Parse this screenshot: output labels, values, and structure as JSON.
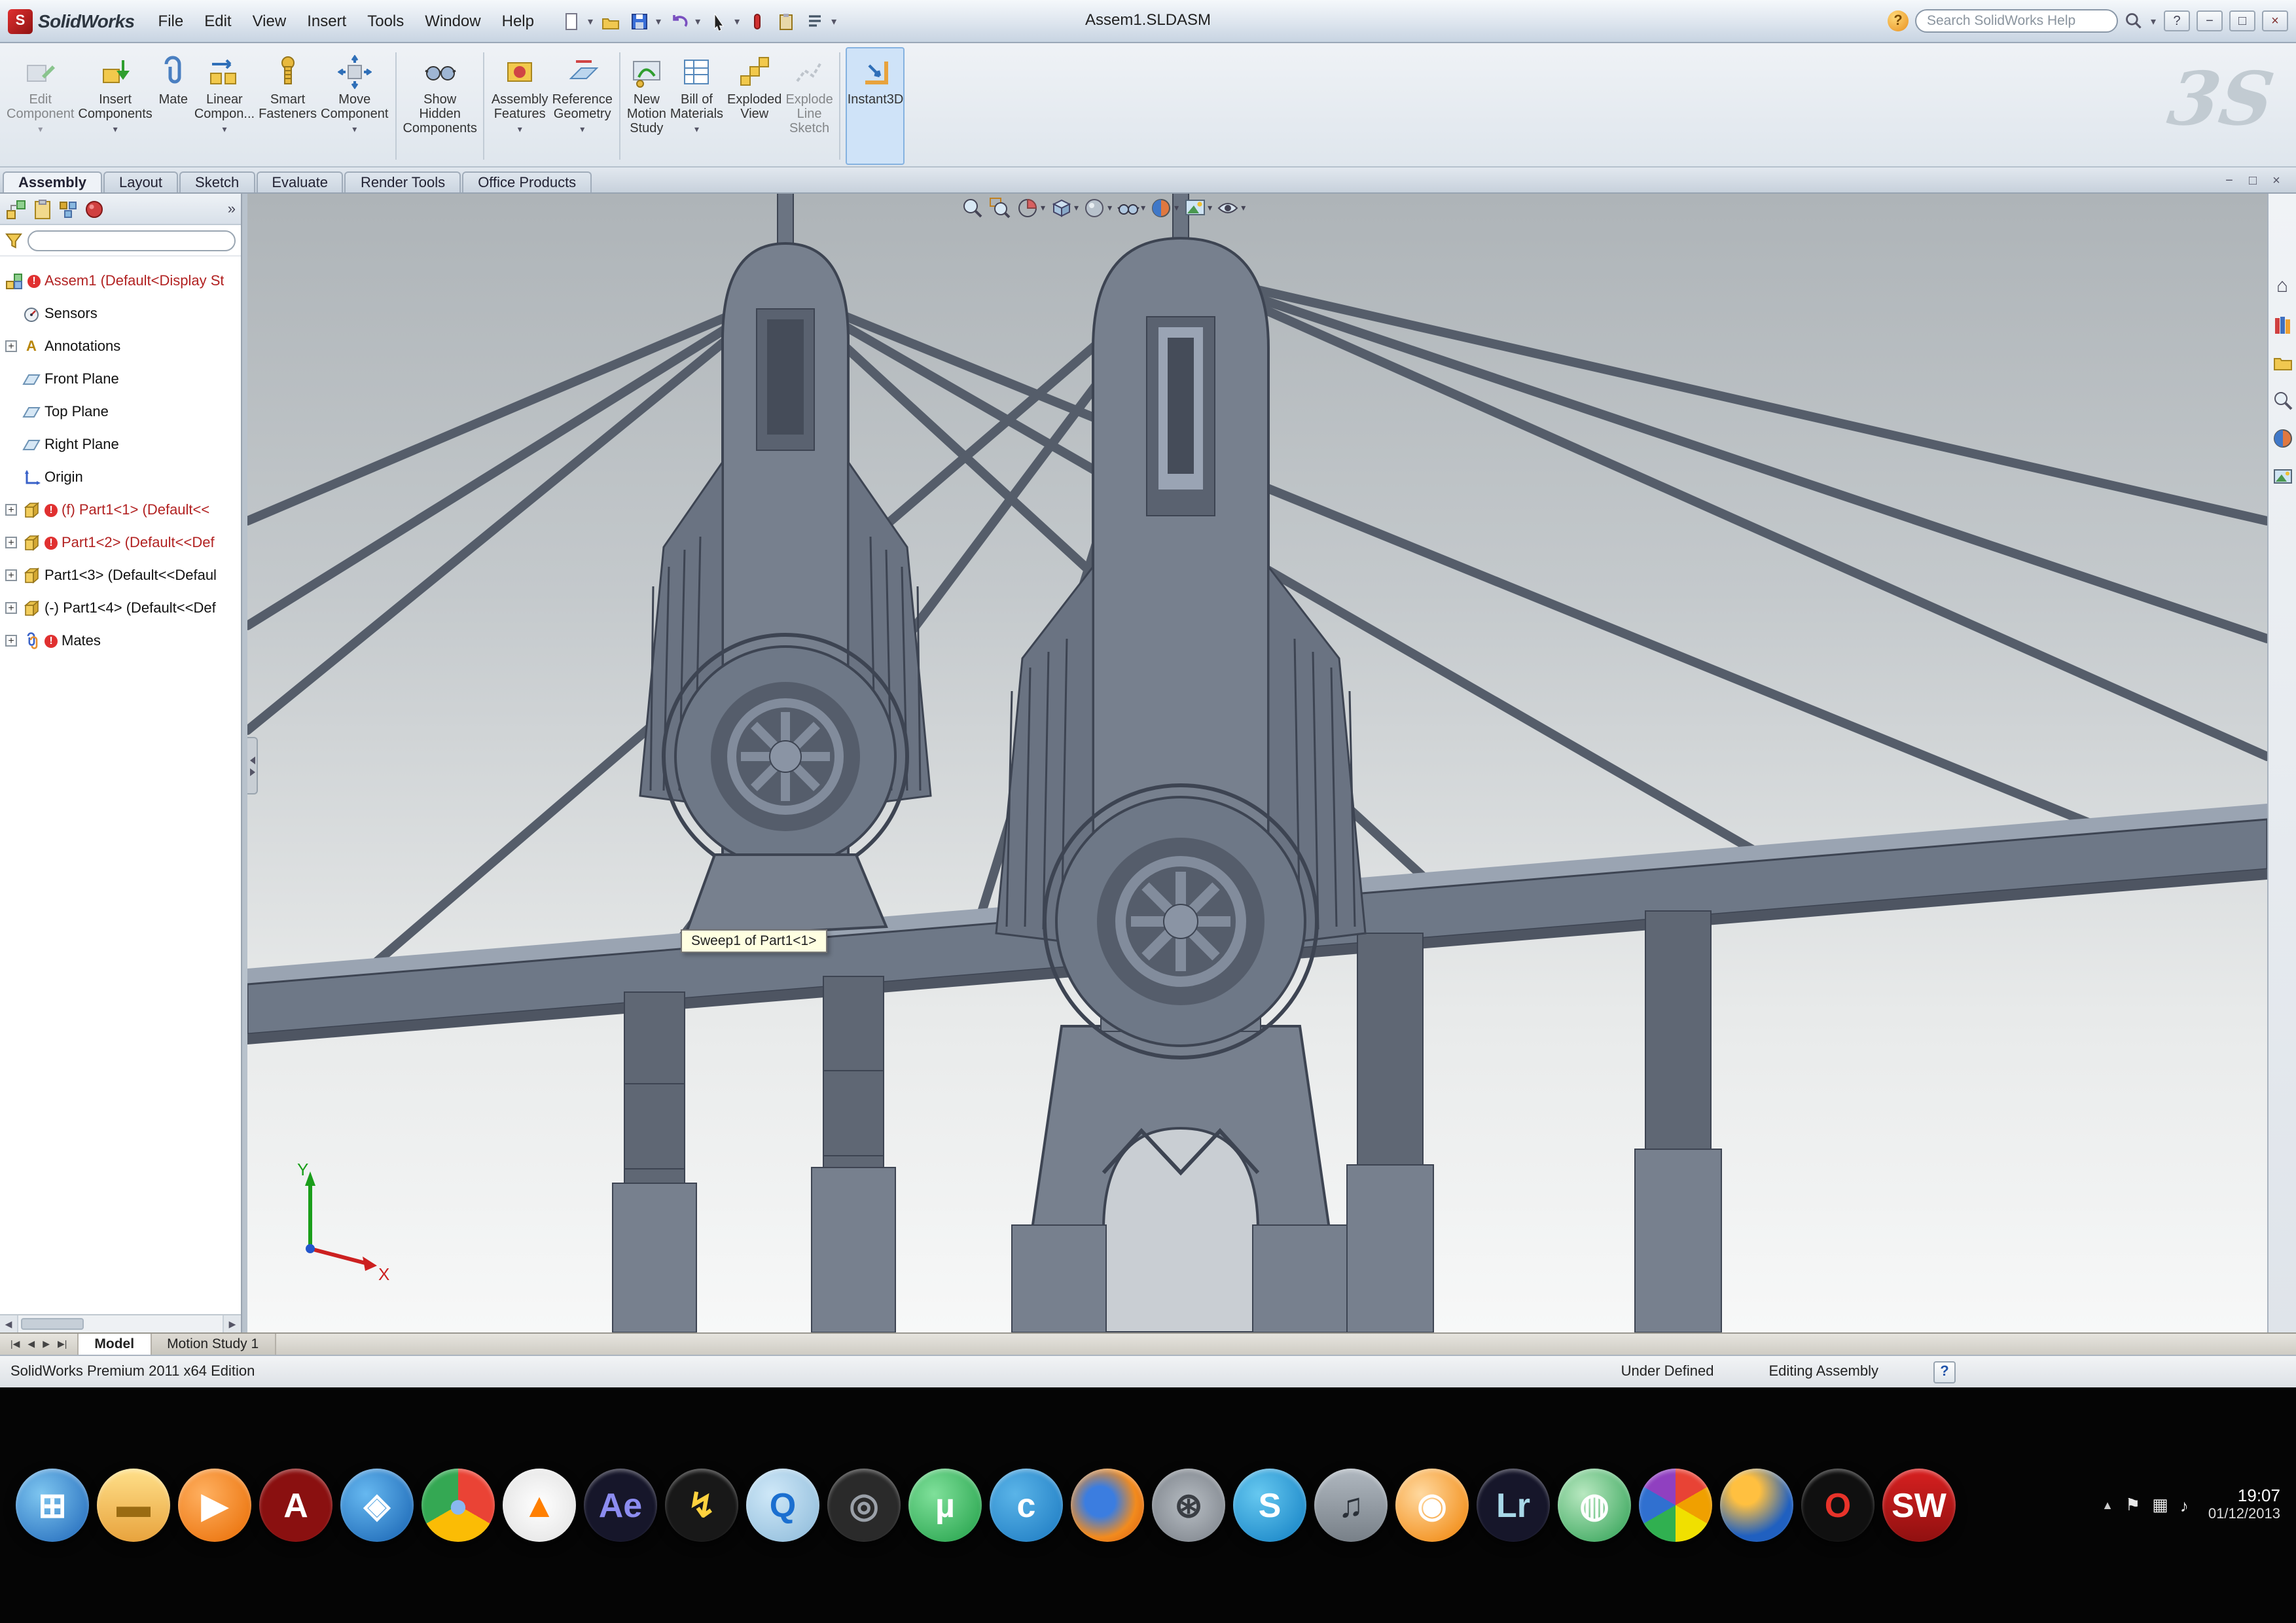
{
  "ui": {
    "caret": "▾",
    "chevrons": "»",
    "plus": "+",
    "error": "!",
    "help": "?",
    "min": "−",
    "max": "□",
    "close": "×"
  },
  "titlebar": {
    "logo_text": "SolidWorks",
    "logo_glyph": "S",
    "menus": [
      "File",
      "Edit",
      "View",
      "Insert",
      "Tools",
      "Window",
      "Help"
    ],
    "document_title": "Assem1.SLDASM",
    "search": {
      "placeholder": "Search SolidWorks Help"
    }
  },
  "ribbon": {
    "watermark": "3S",
    "buttons": [
      {
        "label": "Edit\nComponent"
      },
      {
        "label": "Insert\nComponents"
      },
      {
        "label": "Mate"
      },
      {
        "label": "Linear\nCompon..."
      },
      {
        "label": "Smart\nFasteners"
      },
      {
        "label": "Move\nComponent"
      },
      {
        "label": "Show\nHidden\nComponents"
      },
      {
        "label": "Assembly\nFeatures"
      },
      {
        "label": "Reference\nGeometry"
      },
      {
        "label": "New\nMotion\nStudy"
      },
      {
        "label": "Bill of\nMaterials"
      },
      {
        "label": "Exploded\nView"
      },
      {
        "label": "Explode\nLine\nSketch"
      },
      {
        "label": "Instant3D"
      }
    ],
    "tabs": [
      "Assembly",
      "Layout",
      "Sketch",
      "Evaluate",
      "Render Tools",
      "Office Products"
    ]
  },
  "feature_tree": {
    "items": [
      {
        "label": "Assem1 (Default<Display St"
      },
      {
        "label": "Sensors"
      },
      {
        "label": "Annotations"
      },
      {
        "label": "Front Plane"
      },
      {
        "label": "Top Plane"
      },
      {
        "label": "Right Plane"
      },
      {
        "label": "Origin"
      },
      {
        "label": "(f) Part1<1> (Default<<"
      },
      {
        "label": "Part1<2> (Default<<Def"
      },
      {
        "label": "Part1<3> (Default<<Defaul"
      },
      {
        "label": "(-) Part1<4> (Default<<Def"
      },
      {
        "label": "Mates"
      }
    ],
    "annotations_glyph": "A"
  },
  "viewport": {
    "tooltip": "Sweep1 of Part1<1>",
    "triad": {
      "x": "X",
      "y": "Y"
    }
  },
  "bottom_bar": {
    "nav": [
      "|◀",
      "◀",
      "▶",
      "▶|"
    ],
    "tabs": [
      "Model",
      "Motion Study 1"
    ]
  },
  "statusbar": {
    "edition": "SolidWorks Premium 2011 x64 Edition",
    "constraint_status": "Under Defined",
    "mode": "Editing Assembly"
  },
  "taskbar": {
    "time": "19:07",
    "date": "01/12/2013",
    "tray": {
      "expand": "▲",
      "icons": [
        "⚑",
        "▦",
        "♪"
      ]
    },
    "items": [
      {
        "name": "windows-start",
        "glyph": "⊞",
        "style": "background:radial-gradient(circle at 35% 35%, #7ec6f0, #1c64b8);color:#fff"
      },
      {
        "name": "file-explorer",
        "glyph": "▬",
        "style": "background:linear-gradient(#ffe08a,#e8a33d);color:#9a6b12"
      },
      {
        "name": "media-player",
        "glyph": "▶",
        "style": "background:radial-gradient(circle at 35% 35%, #ffb060, #e86a00);color:#fff"
      },
      {
        "name": "pdf-reader",
        "glyph": "A",
        "style": "background:#8a1010;color:#fff"
      },
      {
        "name": "browser-compass",
        "glyph": "◈",
        "style": "background:radial-gradient(circle at 35% 35%, #66b8f0, #1560b0);color:#fff"
      },
      {
        "name": "chrome",
        "glyph": "●",
        "style": "background:conic-gradient(#ea4335 0 120deg, #fbbc05 120deg 240deg, #34a853 240deg 360deg);color:#8ab8f0"
      },
      {
        "name": "vlc",
        "glyph": "▲",
        "style": "background:radial-gradient(#ffffff, #e0e0e0);color:#ff7f00"
      },
      {
        "name": "after-effects",
        "glyph": "Ae",
        "style": "background:#16162a;color:#8c8cf0;font-size:20px"
      },
      {
        "name": "winamp",
        "glyph": "↯",
        "style": "background:#181818;color:#ffd23e"
      },
      {
        "name": "quicktime",
        "glyph": "Q",
        "style": "background:radial-gradient(circle at 35% 35%, #cfe8f8, #8ab8d8);color:#1b6fd0"
      },
      {
        "name": "utility-app",
        "glyph": "◎",
        "style": "background:#2a2a2a;color:#9aa0a8"
      },
      {
        "name": "utorrent",
        "glyph": "µ",
        "style": "background:radial-gradient(circle at 35% 35%, #7fe09a, #1f9e46);color:#fff"
      },
      {
        "name": "copy-app",
        "glyph": "c",
        "style": "background:radial-gradient(circle at 35% 35%, #5ab4e8, #1a78c0);color:#fff"
      },
      {
        "name": "firefox",
        "glyph": "",
        "style": "background:radial-gradient(circle at 40% 45%, #3b7de0 25%, #f28b1e 60%, #d9560b)"
      },
      {
        "name": "film-reel",
        "glyph": "⊛",
        "style": "background:radial-gradient(#b8bec4, #787e86);color:#3a3e44"
      },
      {
        "name": "skype",
        "glyph": "S",
        "style": "background:radial-gradient(circle at 35% 35%, #66c8f0, #0f7dc2);color:#fff"
      },
      {
        "name": "audio-mixer",
        "glyph": "♫",
        "style": "background:linear-gradient(#b0b8c0,#788088);color:#2a3038"
      },
      {
        "name": "media-center",
        "glyph": "◉",
        "style": "background:radial-gradient(circle at 35% 35%, #ffd9a0, #f08000);color:#fff"
      },
      {
        "name": "lightroom",
        "glyph": "Lr",
        "style": "background:#16162a;color:#a8d8e8;font-size:20px"
      },
      {
        "name": "green-app",
        "glyph": "◍",
        "style": "background:radial-gradient(circle at 35% 35%, #b8e8c0, #2a9e50);color:#fff"
      },
      {
        "name": "pinwheel",
        "glyph": "",
        "style": "background:conic-gradient(#e84335 0 60deg, #f0a000 60deg 120deg, #f0e000 120deg 180deg, #30b050 180deg 240deg, #3070d0 240deg 300deg, #9040c0 300deg 360deg)"
      },
      {
        "name": "web-orb",
        "glyph": "",
        "style": "background:radial-gradient(circle at 35% 30%, #ffc040 20%, #2060c0 65%)"
      },
      {
        "name": "opera",
        "glyph": "O",
        "style": "background:#101010;color:#e8332a"
      },
      {
        "name": "solidworks",
        "glyph": "SW",
        "style": "background:linear-gradient(#d82020,#901010);color:#fff;font-size:18px"
      }
    ]
  },
  "colors": {
    "active_highlight": "#cfe3f8",
    "error_red": "#b22222",
    "model_gray": "#77808e",
    "taskbar_black": "#050505"
  }
}
